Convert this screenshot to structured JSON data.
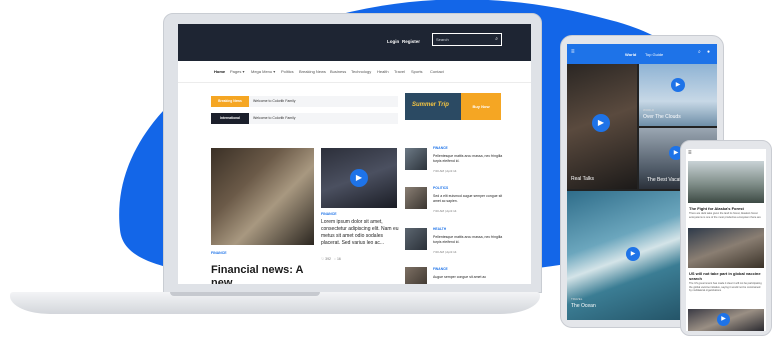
{
  "site": {
    "topbar": {
      "login": "Login",
      "register": "Register",
      "search_placeholder": "Search",
      "search_icon": "search-icon"
    },
    "nav": [
      "Home",
      "Pages ▾",
      "Mega Menu ▾",
      "Politics",
      "Breaking News",
      "Business",
      "Technology",
      "Health",
      "Travel",
      "Sports",
      "Contact"
    ],
    "tickers": [
      {
        "tag": "Breaking News",
        "text": "Welcome to Colorlib Family",
        "color": "#f5a623"
      },
      {
        "tag": "International",
        "text": "Welcome to Colorlib Family",
        "color": "#1b1f2b"
      }
    ],
    "banner": {
      "title": "Summer Trip",
      "button": "Buy Now"
    },
    "hero": {
      "category": "FINANCE",
      "title": "Financial news: A new"
    },
    "video_post": {
      "category": "FINANCE",
      "text": "Lorem ipsum dolor sit amet, consectetur adipiscing elit. Nam eu metus sit amet odio sodales placerat. Sed varius leo ac...",
      "likes": "392",
      "comments": "16"
    },
    "sidebar": [
      {
        "category": "FINANCE",
        "title": "Pellentesque mattis arcu massa, nec fringilla turpis eleifend id.",
        "date": "7:00 AM | April 14"
      },
      {
        "category": "POLITICS",
        "title": "Sed a elit euismod augue semper congue sit amet ac sapien.",
        "date": "7:00 AM | April 14"
      },
      {
        "category": "HEALTH",
        "title": "Pellentesque mattis arcu massa, nec fringilla turpis eleifend id.",
        "date": "7:00 AM | April 14"
      },
      {
        "category": "FINANCE",
        "title": "Augue semper congue sit amet ac",
        "date": ""
      }
    ]
  },
  "tablet": {
    "tabs": [
      "World",
      "Top Guide"
    ],
    "cells": [
      {
        "kicker": "",
        "label": "Real Talks"
      },
      {
        "kicker": "WORLD",
        "label": "Over The Clouds"
      },
      {
        "kicker": "",
        "label": "The Best Vacation"
      },
      {
        "kicker": "TRAVEL",
        "label": "The Ocean"
      }
    ]
  },
  "phone": {
    "story1": {
      "title": "The Fight for Alaska's Forest",
      "text": "There are dark tales given the land its forest, Alaska's forest ecosystems is one of the most productive ecosystem there are"
    },
    "story2": {
      "title": "US will not take part in global vaccine search",
      "text": "The US government has made it clear it will not be participating the global vaccine initiative, saying it would not be constrained by multilateral organizations"
    }
  }
}
